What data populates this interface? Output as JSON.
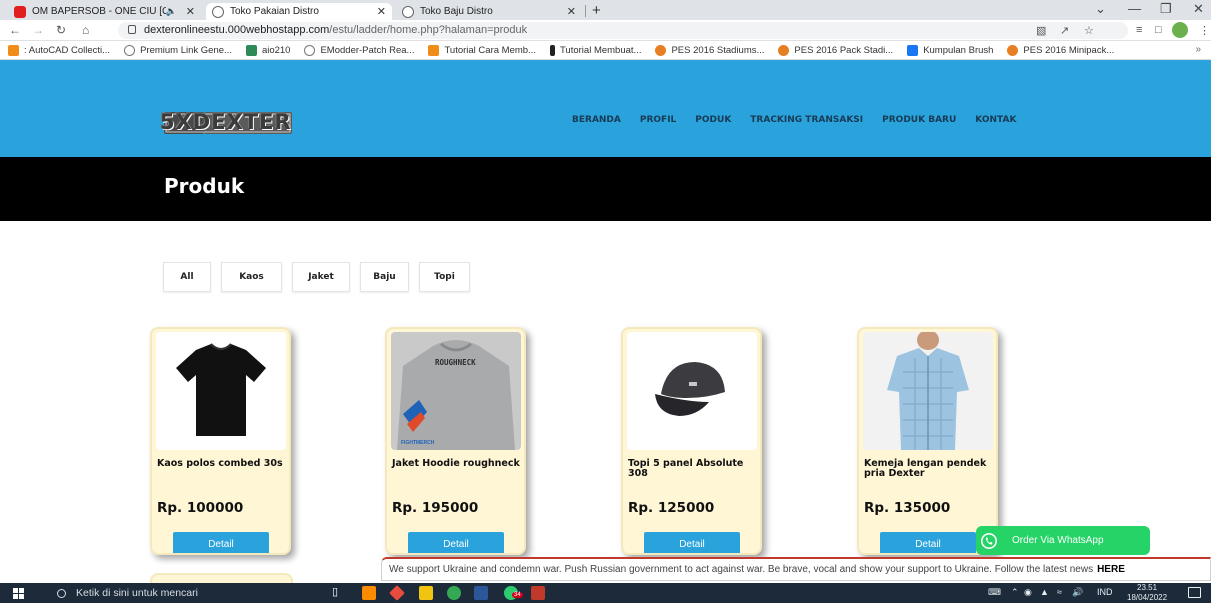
{
  "browser": {
    "tabs": [
      {
        "title": "OM BAPERSOB - ONE CIU [C",
        "icon": "youtube-icon",
        "audio": true,
        "active": false
      },
      {
        "title": "Toko Pakaian Distro",
        "icon": "globe-icon",
        "active": true
      },
      {
        "title": "Toko Baju Distro",
        "icon": "globe-icon",
        "active": false
      }
    ],
    "url_host": "dexteronlineestu.000webhostapp.com",
    "url_path": "/estu/ladder/home.php?halaman=produk",
    "bookmarks": [
      {
        "label": ": AutoCAD Collecti...",
        "icon": "orange"
      },
      {
        "label": "Premium Link Gene...",
        "icon": "globe"
      },
      {
        "label": "aio210",
        "icon": "green"
      },
      {
        "label": "EModder-Patch Rea...",
        "icon": "globe"
      },
      {
        "label": "Tutorial Cara Memb...",
        "icon": "orange"
      },
      {
        "label": "Tutorial Membuat...",
        "icon": "dark"
      },
      {
        "label": "PES 2016 Stadiums...",
        "icon": "pes"
      },
      {
        "label": "PES 2016 Pack Stadi...",
        "icon": "pes"
      },
      {
        "label": "Kumpulan Brush",
        "icon": "fb"
      },
      {
        "label": "PES 2016 Minipack...",
        "icon": "pes"
      }
    ],
    "bookmarks_more": "»"
  },
  "site": {
    "logo_text": "5XDEXTER",
    "menu": [
      "BERANDA",
      "PROFIL",
      "PODUK",
      "TRACKING TRANSAKSI",
      "PRODUK BARU",
      "KONTAK"
    ],
    "page_title": "Produk",
    "filters": [
      "All",
      "Kaos",
      "Jaket",
      "Baju",
      "Topi"
    ],
    "products": [
      {
        "name": "Kaos polos combed 30s",
        "price": "Rp. 100000",
        "button": "Detail",
        "image": "black-tshirt"
      },
      {
        "name": "Jaket Hoodie roughneck",
        "price": "Rp. 195000",
        "button": "Detail",
        "image": "grey-hoodie",
        "print": "ROUGHNECK"
      },
      {
        "name": "Topi 5 panel Absolute 308",
        "price": "Rp. 125000",
        "button": "Detail",
        "image": "dark-cap"
      },
      {
        "name": "Kemeja lengan pendek pria Dexter",
        "price": "Rp. 135000",
        "button": "Detail",
        "image": "blue-shirt"
      }
    ],
    "whatsapp_label": "Order Via WhatsApp",
    "ukraine_text": "We support Ukraine and condemn war. Push Russian government to act against war. Be brave, vocal and show your support to Ukraine. Follow the latest news",
    "ukraine_link": "HERE"
  },
  "taskbar": {
    "search_placeholder": "Ketik di sini untuk mencari",
    "lang": "IND",
    "time": "23.51",
    "date": "18/04/2022",
    "badge": "34"
  }
}
